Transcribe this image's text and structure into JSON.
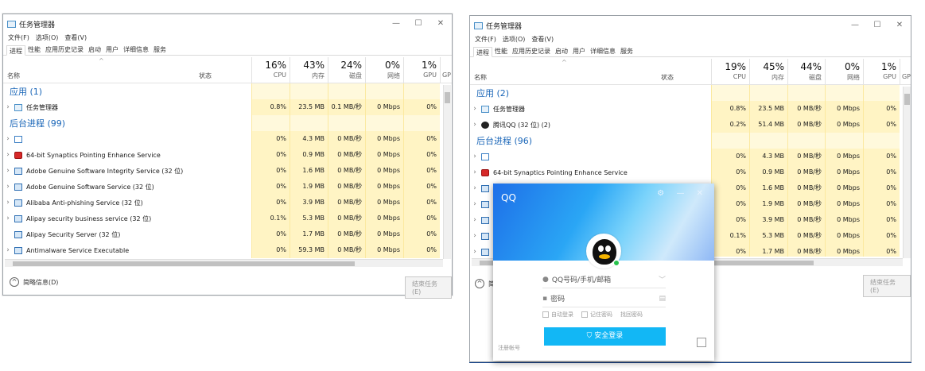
{
  "left": {
    "title": "任务管理器",
    "controls": [
      "—",
      "☐",
      "✕"
    ],
    "menu": [
      "文件(F)",
      "选项(O)",
      "查看(V)"
    ],
    "tabs": [
      "进程",
      "性能",
      "应用历史记录",
      "启动",
      "用户",
      "详细信息",
      "服务"
    ],
    "headers": {
      "name": "名称",
      "status": "状态",
      "cpu_pct": "16%",
      "cpu": "CPU",
      "mem_pct": "43%",
      "mem": "内存",
      "disk_pct": "24%",
      "disk": "磁盘",
      "net_pct": "0%",
      "net": "网络",
      "gpu_pct": "1%",
      "gpu": "GPU",
      "gpu_cut": "GP"
    },
    "group_apps": "应用 (1)",
    "group_bg": "后台进程 (99)",
    "apps": [
      {
        "name": "任务管理器",
        "cpu": "0.8%",
        "mem": "23.5 MB",
        "disk": "0.1 MB/秒",
        "net": "0 Mbps",
        "gpu": "0%"
      }
    ],
    "background": [
      {
        "name": "",
        "cpu": "0%",
        "mem": "4.3 MB",
        "disk": "0 MB/秒",
        "net": "0 Mbps",
        "gpu": "0%"
      },
      {
        "name": "64-bit Synaptics Pointing Enhance Service",
        "cpu": "0%",
        "mem": "0.9 MB",
        "disk": "0 MB/秒",
        "net": "0 Mbps",
        "gpu": "0%"
      },
      {
        "name": "Adobe Genuine Software Integrity Service (32 位)",
        "cpu": "0%",
        "mem": "1.6 MB",
        "disk": "0 MB/秒",
        "net": "0 Mbps",
        "gpu": "0%"
      },
      {
        "name": "Adobe Genuine Software Service (32 位)",
        "cpu": "0%",
        "mem": "1.9 MB",
        "disk": "0 MB/秒",
        "net": "0 Mbps",
        "gpu": "0%"
      },
      {
        "name": "Alibaba Anti-phishing Service (32 位)",
        "cpu": "0%",
        "mem": "3.9 MB",
        "disk": "0 MB/秒",
        "net": "0 Mbps",
        "gpu": "0%"
      },
      {
        "name": "Alipay security business service (32 位)",
        "cpu": "0.1%",
        "mem": "5.3 MB",
        "disk": "0 MB/秒",
        "net": "0 Mbps",
        "gpu": "0%"
      },
      {
        "name": "Alipay Security Server (32 位)",
        "cpu": "0%",
        "mem": "1.7 MB",
        "disk": "0 MB/秒",
        "net": "0 Mbps",
        "gpu": "0%"
      },
      {
        "name": "Antimalware Service Executable",
        "cpu": "0%",
        "mem": "59.3 MB",
        "disk": "0 MB/秒",
        "net": "0 Mbps",
        "gpu": "0%"
      }
    ],
    "footer_label": "简略信息(D)",
    "end_task": "结束任务(E)"
  },
  "right": {
    "title": "任务管理器",
    "controls": [
      "—",
      "☐",
      "✕"
    ],
    "menu": [
      "文件(F)",
      "选项(O)",
      "查看(V)"
    ],
    "tabs": [
      "进程",
      "性能",
      "应用历史记录",
      "启动",
      "用户",
      "详细信息",
      "服务"
    ],
    "headers": {
      "name": "名称",
      "status": "状态",
      "cpu_pct": "19%",
      "cpu": "CPU",
      "mem_pct": "45%",
      "mem": "内存",
      "disk_pct": "44%",
      "disk": "磁盘",
      "net_pct": "0%",
      "net": "网络",
      "gpu_pct": "1%",
      "gpu": "GPU",
      "gpu_cut": "GP"
    },
    "group_apps": "应用 (2)",
    "group_bg": "后台进程 (96)",
    "apps": [
      {
        "name": "任务管理器",
        "cpu": "0.8%",
        "mem": "23.5 MB",
        "disk": "0 MB/秒",
        "net": "0 Mbps",
        "gpu": "0%"
      },
      {
        "name": "腾讯QQ (32 位) (2)",
        "cpu": "0.2%",
        "mem": "51.4 MB",
        "disk": "0 MB/秒",
        "net": "0 Mbps",
        "gpu": "0%"
      }
    ],
    "background": [
      {
        "name": "",
        "cpu": "0%",
        "mem": "4.3 MB",
        "disk": "0 MB/秒",
        "net": "0 Mbps",
        "gpu": "0%"
      },
      {
        "name": "64-bit Synaptics Pointing Enhance Service",
        "cpu": "0%",
        "mem": "0.9 MB",
        "disk": "0 MB/秒",
        "net": "0 Mbps",
        "gpu": "0%"
      },
      {
        "name": "",
        "cpu": "0%",
        "mem": "1.6 MB",
        "disk": "0 MB/秒",
        "net": "0 Mbps",
        "gpu": "0%"
      },
      {
        "name": "",
        "cpu": "0%",
        "mem": "1.9 MB",
        "disk": "0 MB/秒",
        "net": "0 Mbps",
        "gpu": "0%"
      },
      {
        "name": "",
        "cpu": "0%",
        "mem": "3.9 MB",
        "disk": "0 MB/秒",
        "net": "0 Mbps",
        "gpu": "0%"
      },
      {
        "name": "",
        "cpu": "0.1%",
        "mem": "5.3 MB",
        "disk": "0 MB/秒",
        "net": "0 Mbps",
        "gpu": "0%"
      },
      {
        "name": "",
        "cpu": "0%",
        "mem": "1.7 MB",
        "disk": "0 MB/秒",
        "net": "0 Mbps",
        "gpu": "0%"
      }
    ],
    "footer_label": "简",
    "end_task": "结束任务(E)"
  },
  "qq": {
    "logo": "QQ",
    "controls": "⚙ — ✕",
    "account_placeholder": "QQ号码/手机/邮箱",
    "password_placeholder": "密码",
    "auto_login": "自动登录",
    "remember": "记住密码",
    "recover": "找回密码",
    "login": "安全登录",
    "register": "注册帐号"
  }
}
